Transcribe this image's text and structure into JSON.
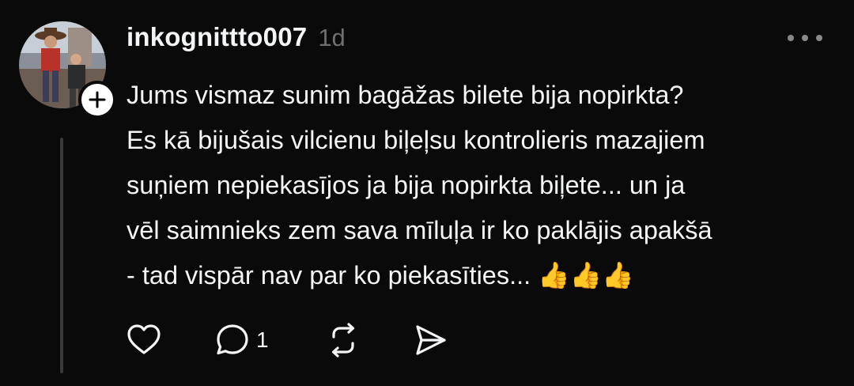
{
  "post": {
    "username": "inkognittto007",
    "timestamp": "1d",
    "text_lines": [
      "Jums vismaz sunim bagāžas bilete bija nopirkta?",
      "Es kā bijušais vilcienu biļeļsu kontrolieris mazajiem",
      "suņiem nepiekasījos ja bija nopirkta biļete... un ja",
      "vēl saimnieks zem sava mīluļa ir ko paklājis apakšā",
      "- tad vispār nav par ko piekasīties... 👍👍👍"
    ],
    "reply_count": "1"
  },
  "icons": {
    "more": "more-horizontal-icon",
    "follow": "plus-icon",
    "like": "heart-icon",
    "reply": "comment-icon",
    "repost": "repost-icon",
    "share": "send-icon"
  },
  "colors": {
    "background": "#0a0a0a",
    "text": "#f3f5f7",
    "muted": "#6f6f6f",
    "thread_line": "#3a3a3a"
  }
}
